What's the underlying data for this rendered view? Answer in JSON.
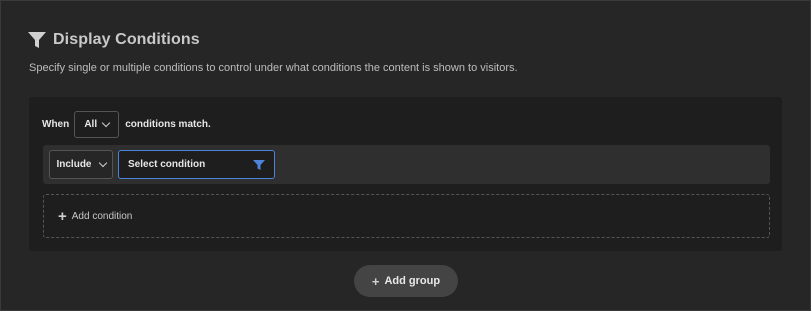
{
  "header": {
    "title": "Display Conditions",
    "description": "Specify single or multiple conditions to control under what conditions the content is shown to visitors."
  },
  "group": {
    "when_label": "When",
    "match_value": "All",
    "match_suffix": "conditions match.",
    "condition": {
      "type_value": "Include",
      "select_placeholder": "Select condition"
    },
    "add_condition_label": "Add condition"
  },
  "add_group_label": "Add group",
  "colors": {
    "background": "#262626",
    "group_background": "#1e1e1e",
    "accent": "#4d83d9"
  },
  "icons": {
    "header": "filter-icon",
    "select": "filter-icon",
    "add": "plus-icon",
    "dropdown": "chevron-down-icon"
  }
}
